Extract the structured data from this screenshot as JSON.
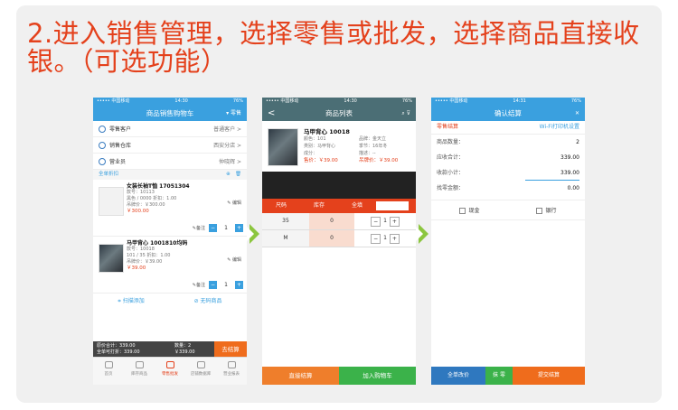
{
  "heading": "2.进入销售管理，选择零售或批发，选择商品直接收银。（可选功能）",
  "colors": {
    "accent": "#e4411c",
    "blue": "#3aa0df",
    "green_arrow": "#8cc63f",
    "orange": "#ef6c1c",
    "green": "#3bb24a"
  },
  "screen1": {
    "status": {
      "carrier": "••••• 中国移动",
      "time": "14:30",
      "battery": "76%"
    },
    "title": "商品销售购物车",
    "nav_right": "▾ 零售",
    "rows": [
      {
        "label": "零售客户",
        "value": "普通客户 >"
      },
      {
        "label": "销售仓库",
        "value": "西安分店 >"
      },
      {
        "label": "营业员",
        "value": "仲晓辉 >"
      }
    ],
    "section_label": "全单折扣",
    "items": [
      {
        "name": "女装长袖T恤 17051304",
        "lines": [
          "款号：10113",
          "黑色 / 0000  折扣：1.00",
          "吊牌价：￥300.00"
        ],
        "price": "￥300.00",
        "note": "备注",
        "edit": "编辑",
        "qty": "1"
      },
      {
        "name": "马甲背心 1001810均码",
        "lines": [
          "款号：10018",
          "101 / 35  折扣：1.00",
          "吊牌价：￥39.00"
        ],
        "price": "￥39.00",
        "note": "备注",
        "edit": "编辑",
        "qty": "1"
      }
    ],
    "scan_add": "扫描添加",
    "no_barcode": "无码商品",
    "totals": {
      "line1": "原价合计：339.00",
      "line2": "全单可打折：339.00",
      "qty": "数量：2",
      "amount": "￥339.00"
    },
    "checkout": "去结算",
    "tabs": [
      "首页",
      "库存商品",
      "零售批发",
      "店铺数据库",
      "营业报表"
    ]
  },
  "screen2": {
    "status": {
      "carrier": "••••• 中国移动",
      "time": "14:30",
      "battery": "76%"
    },
    "title": "商品列表",
    "back": "<",
    "product": {
      "name": "马甲背心 10018",
      "attrs": [
        [
          "颜色：101",
          "品牌：金天立"
        ],
        [
          "类别：马甲背心",
          "季节：16年冬"
        ],
        [
          "成分：",
          "描述：--"
        ],
        [
          "售价：￥39.00",
          "吊牌价：￥39.00"
        ]
      ]
    },
    "size_head": [
      "尺码",
      "库存",
      "全填"
    ],
    "sizes": [
      {
        "size": "35",
        "stock": "0",
        "qty": "1"
      },
      {
        "size": "M",
        "stock": "0",
        "qty": "1"
      }
    ],
    "btn_direct": "直接结算",
    "btn_cart": "加入购物车"
  },
  "screen3": {
    "status": {
      "carrier": "••••• 中国移动",
      "time": "14:31",
      "battery": "76%"
    },
    "title": "确认结算",
    "close": "✕",
    "section_label": "零售结算",
    "print_link": "Wi-Fi打印机设置",
    "rows": [
      {
        "label": "商品数量：",
        "value": "2"
      },
      {
        "label": "应收合计：",
        "value": "339.00"
      },
      {
        "label": "收款小计：",
        "value": "339.00"
      },
      {
        "label": "找零金额：",
        "value": "0.00"
      }
    ],
    "pay": [
      "现金",
      "银行"
    ],
    "btn_discount": "全单改价",
    "btn_change": "抹 零",
    "btn_submit": "提交结算"
  }
}
